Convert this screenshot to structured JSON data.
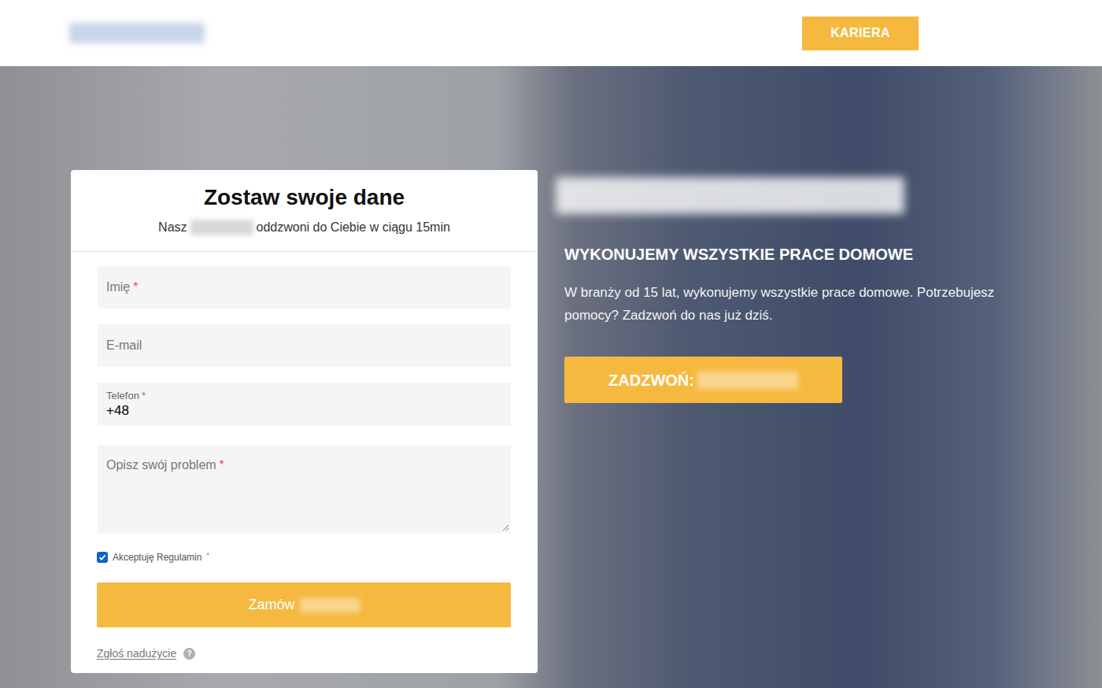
{
  "header": {
    "career_button": "KARIERA"
  },
  "form": {
    "title": "Zostaw swoje dane",
    "subtitle_before": "Nasz",
    "subtitle_after": "oddzwoni do Ciebie w ciągu 15min",
    "required_mark": "*",
    "fields": [
      {
        "kind": "input",
        "label": "Imię",
        "required": true,
        "value": ""
      },
      {
        "kind": "input",
        "label": "E-mail",
        "required": false,
        "value": ""
      },
      {
        "kind": "phone",
        "label": "Telefon",
        "required": true,
        "value": "+48"
      },
      {
        "kind": "textarea",
        "label": "Opisz swój problem",
        "required": true,
        "value": ""
      }
    ],
    "terms": {
      "label": "Akceptuję Regulamin",
      "required": true,
      "checked": true
    },
    "submit": "Zamów",
    "report": "Zgłoś nadużycie",
    "help_icon": "?"
  },
  "hero": {
    "heading": "WYKONUJEMY WSZYSTKIE PRACE DOMOWE",
    "description": "W branży od 15 lat, wykonujemy wszystkie prace domowe. Potrzebujesz pomocy? Zadzwoń do nas już dziś.",
    "call_button": "ZADZWOŃ:"
  }
}
